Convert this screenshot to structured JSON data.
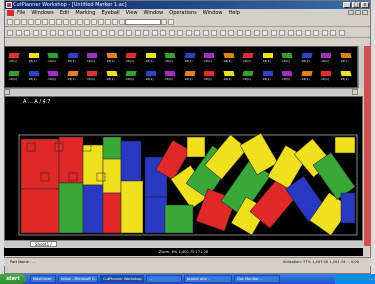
{
  "window": {
    "title": "CutPlanner Workshop - [Untitled Marker 1.ac]",
    "buttons": [
      "_",
      "□",
      "x"
    ]
  },
  "menu": [
    "File",
    "Windows",
    "Edit",
    "Marking",
    "Eyeball",
    "View",
    "Window",
    "Operations",
    "Window",
    "Help"
  ],
  "marker": {
    "title": "A ... A / 4.7",
    "sheet_tab": "Sheet1 /"
  },
  "zoom_info": "Zoom: 6%   4,400.75   171.28",
  "status": {
    "left": "Part Name : ...",
    "right": "Utilization: 77%   1,447.00   1,201.74   ...   0.00"
  },
  "taskbar": {
    "start": "start",
    "tasks": [
      "Maximizer",
      "Inbox - Microsoft O...",
      "CutPlanner Workshop",
      "...",
      "Joseph and ...",
      "Doc Monitor..."
    ],
    "tray_time": "..."
  },
  "piece_row_labels": [
    ".18(1)",
    ".18(1)",
    ".18(1)",
    ".18(1)",
    ".18(1)",
    ".18(1)",
    ".18(1)",
    ".18(1)",
    ".18(1)",
    ".18(1)",
    ".18(1)",
    ".18(1)",
    ".18(1)",
    ".18(1)",
    ".18(1)",
    ".18(1)",
    ".18(1)",
    ".18(1)"
  ],
  "piece_colors": [
    "#e03030",
    "#e8e020",
    "#30a030",
    "#3040c0",
    "#a030c0",
    "#e08020"
  ]
}
